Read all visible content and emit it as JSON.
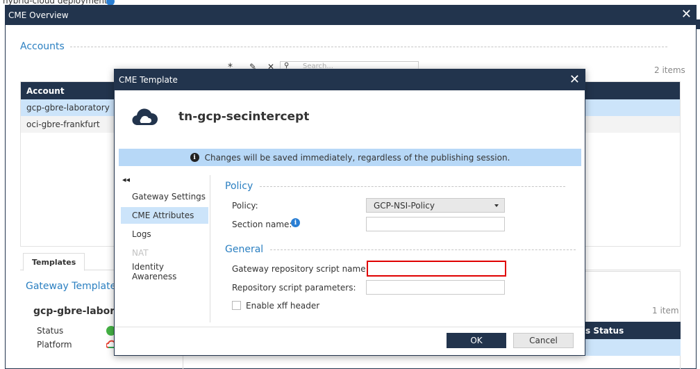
{
  "background": {
    "top_text": "hybrid-cloud deployments"
  },
  "outer_dialog": {
    "title": "CME Overview",
    "close_glyph": "✕",
    "accounts_heading": "Accounts",
    "items_count": "2 items",
    "toolbar_icons": [
      "asterisk-icon",
      "edit-icon",
      "delete-icon",
      "search-icon"
    ],
    "search_placeholder": "Search...",
    "table": {
      "column": "Account",
      "rows": [
        "gcp-gbre-laboratory",
        "oci-gbre-frankfurt"
      ],
      "selected_index": 0
    },
    "tabs": [
      "Templates"
    ],
    "gateway_templates_heading": "Gateway Templates",
    "gateway_name": "gcp-gbre-laboratory",
    "fields": [
      {
        "label": "Status",
        "icon": "status-ok-icon"
      },
      {
        "label": "Platform",
        "icon": "gcp-cloud-icon"
      }
    ],
    "right_count": "1 item",
    "right_column": "s Status"
  },
  "inner_dialog": {
    "title": "CME Template",
    "close_glyph": "✕",
    "template_icon": "cloud-icon",
    "template_name": "tn-gcp-secintercept",
    "banner": "Changes will be saved immediately, regardless of the publishing session.",
    "collapse_glyph": "◂◂",
    "nav": [
      {
        "label": "Gateway Settings",
        "selected": false,
        "disabled": false
      },
      {
        "label": "CME Attributes",
        "selected": true,
        "disabled": false
      },
      {
        "label": "Logs",
        "selected": false,
        "disabled": false
      },
      {
        "label": "NAT",
        "selected": false,
        "disabled": true
      },
      {
        "label": "Identity Awareness",
        "selected": false,
        "disabled": false
      }
    ],
    "policy_heading": "Policy",
    "policy_label": "Policy:",
    "policy_value": "GCP-NSI-Policy",
    "section_label": "Section name:",
    "section_value": "",
    "general_heading": "General",
    "repo_script_label": "Gateway repository script name:",
    "repo_script_value": "",
    "repo_params_label": "Repository script parameters:",
    "repo_params_value": "",
    "xff_label": "Enable xff header",
    "xff_checked": false,
    "ok_label": "OK",
    "cancel_label": "Cancel"
  }
}
